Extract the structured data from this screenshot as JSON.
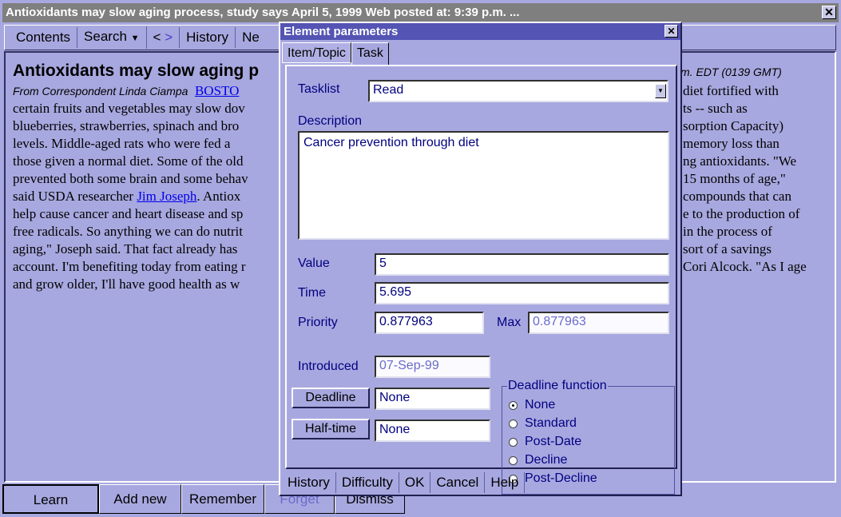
{
  "window": {
    "title": "Antioxidants may slow aging process, study says April 5, 1999 Web posted at: 9:39 p.m. ...",
    "close_icon": "close-icon"
  },
  "toolbar": {
    "items": [
      "Contents",
      "Search",
      "<",
      ">",
      "History",
      "Ne"
    ]
  },
  "article": {
    "headline": "Antioxidants may slow aging p",
    "headline_right": "m. EDT (0139 GMT)",
    "byline": "From Correspondent Linda Ciampa",
    "byline_link": "BOSTO",
    "left_lines": [
      "certain fruits and vegetables may slow dov",
      "blueberries, strawberries, spinach and bro",
      "levels.  Middle-aged rats who were fed a",
      "those given a normal diet. Some of the old",
      "prevented both some brain and some behav",
      "said USDA researcher ",
      "help cause cancer and heart disease and sp",
      "free radicals. So anything we can do nutrit",
      "aging,\" Joseph said.  That fact already has",
      "account. I'm benefiting today from eating r",
      "and grow older, I'll have good health as w"
    ],
    "link_name": "Jim Joseph",
    "after_link": ".  Antiox",
    "right_lines": [
      "diet fortified with",
      "ts -- such as",
      "sorption Capacity)",
      "memory loss than",
      "ng antioxidants.  \"We",
      "15 months of age,\"",
      "compounds that can",
      "e to the production of",
      "in the process of",
      "sort of a savings",
      "Cori Alcock. \"As I age"
    ]
  },
  "bottom_buttons": [
    {
      "label": "Learn"
    },
    {
      "label": "Add new"
    },
    {
      "label": "Remember"
    },
    {
      "label": "Forget",
      "disabled": true
    },
    {
      "label": "Dismiss"
    }
  ],
  "dialog": {
    "title": "Element parameters",
    "tabs": [
      {
        "label": "Item/Topic"
      },
      {
        "label": "Task",
        "active": true
      }
    ],
    "tasklist_label": "Tasklist",
    "tasklist_value": "Read",
    "description_label": "Description",
    "description_value": "Cancer prevention through diet",
    "value_label": "Value",
    "value_value": "5",
    "time_label": "Time",
    "time_value": "5.695",
    "priority_label": "Priority",
    "priority_value": "0.877963",
    "max_label": "Max",
    "max_value": "0.877963",
    "introduced_label": "Introduced",
    "introduced_value": "07-Sep-99",
    "deadline_button": "Deadline",
    "deadline_value": "None",
    "halftime_button": "Half-time",
    "halftime_value": "None",
    "deadline_function": {
      "label": "Deadline function",
      "options": [
        "None",
        "Standard",
        "Post-Date",
        "Decline",
        "Post-Decline"
      ],
      "selected": "None"
    },
    "buttons": [
      "History",
      "Difficulty",
      "OK",
      "Cancel",
      "Help"
    ]
  },
  "colors": {
    "background": "#a8a8e0",
    "dialog_title": "#5454b4",
    "label_text": "#000080",
    "link": "#0000ee"
  }
}
